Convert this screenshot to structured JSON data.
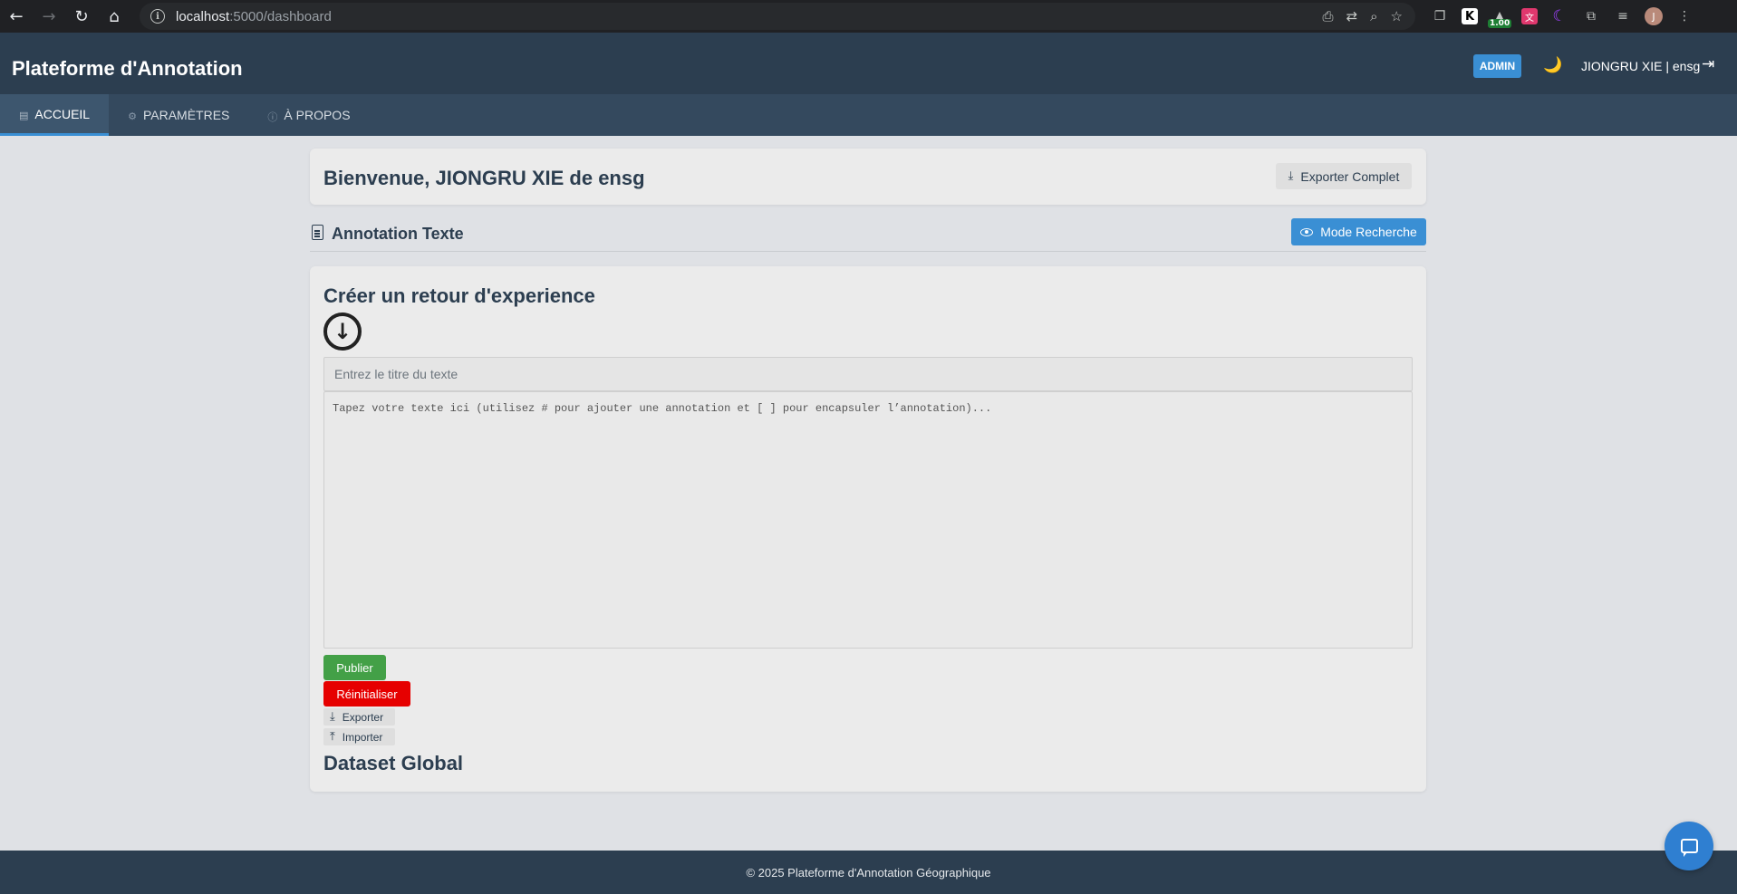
{
  "browser": {
    "url_host": "localhost",
    "url_path": ":5000/dashboard",
    "extension_badge": "1.00",
    "profile_initial": "J"
  },
  "header": {
    "brand": "Plateforme d'Annotation",
    "role_badge": "ADMIN",
    "theme_icon": "🌙",
    "user_label": "JIONGRU XIE | ensg"
  },
  "tabs": [
    {
      "label": "ACCUEIL",
      "icon": "document-icon",
      "active": true
    },
    {
      "label": "PARAMÈTRES",
      "icon": "gear-icon",
      "active": false
    },
    {
      "label": "À PROPOS",
      "icon": "info-icon",
      "active": false
    }
  ],
  "welcome": {
    "title": "Bienvenue, JIONGRU XIE de ensg",
    "export_button": "Exporter Complet"
  },
  "section": {
    "title": "Annotation Texte",
    "mode_button": "Mode Recherche"
  },
  "editor": {
    "title": "Créer un retour d'experience",
    "title_placeholder": "Entrez le titre du texte",
    "text_placeholder": "Tapez votre texte ici (utilisez # pour ajouter une annotation et [ ] pour encapsuler l’annotation)...",
    "publish_button": "Publier",
    "reset_button": "Réinitialiser",
    "export_button": "Exporter",
    "import_button": "Importer",
    "dataset_title": "Dataset Global"
  },
  "footer": {
    "text": "© 2025 Plateforme d'Annotation Géographique"
  },
  "colors": {
    "header_bg": "#2c3e50",
    "tabs_bg": "#34495e",
    "accent": "#3a8fd4",
    "publish": "#43a047",
    "reset": "#e60000"
  }
}
